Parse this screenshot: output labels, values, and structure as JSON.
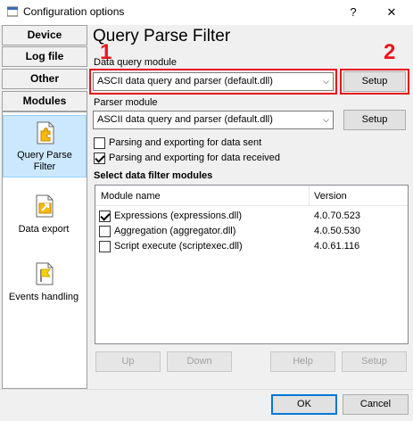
{
  "window": {
    "title": "Configuration options",
    "help_button": "?",
    "close_button": "✕"
  },
  "tabs": [
    "Device",
    "Log file",
    "Other",
    "Modules"
  ],
  "sidebar": {
    "items": [
      {
        "label_line1": "Query Parse",
        "label_line2": "Filter",
        "icon": "puzzle-document-icon",
        "selected": true
      },
      {
        "label_line1": "Data export",
        "label_line2": "",
        "icon": "export-document-icon",
        "selected": false
      },
      {
        "label_line1": "Events handling",
        "label_line2": "",
        "icon": "flag-document-icon",
        "selected": false
      }
    ]
  },
  "main": {
    "heading": "Query Parse Filter",
    "data_query_module_label": "Data query module",
    "data_query_module_value": "ASCII data query and parser (default.dll)",
    "setup_label": "Setup",
    "parser_module_label": "Parser module",
    "parser_module_value": "ASCII data query and parser (default.dll)",
    "parser_setup_label": "Setup",
    "chk_sent_label": "Parsing and exporting for data sent",
    "chk_sent_checked": false,
    "chk_received_label": "Parsing and exporting for data received",
    "chk_received_checked": true,
    "filter_section_label": "Select data filter modules",
    "list_headers": {
      "name": "Module name",
      "version": "Version"
    },
    "modules": [
      {
        "name": "Expressions (expressions.dll)",
        "version": "4.0.70.523",
        "checked": true
      },
      {
        "name": "Aggregation (aggregator.dll)",
        "version": "4.0.50.530",
        "checked": false
      },
      {
        "name": "Script execute (scriptexec.dll)",
        "version": "4.0.61.116",
        "checked": false
      }
    ],
    "list_buttons": {
      "up": "Up",
      "down": "Down",
      "help": "Help",
      "setup": "Setup"
    }
  },
  "annotations": {
    "marker1": "1",
    "marker2": "2",
    "color": "#e8161b"
  },
  "footer": {
    "ok": "OK",
    "cancel": "Cancel"
  },
  "colors": {
    "selection": "#cce8ff",
    "accent": "#0078d7"
  }
}
